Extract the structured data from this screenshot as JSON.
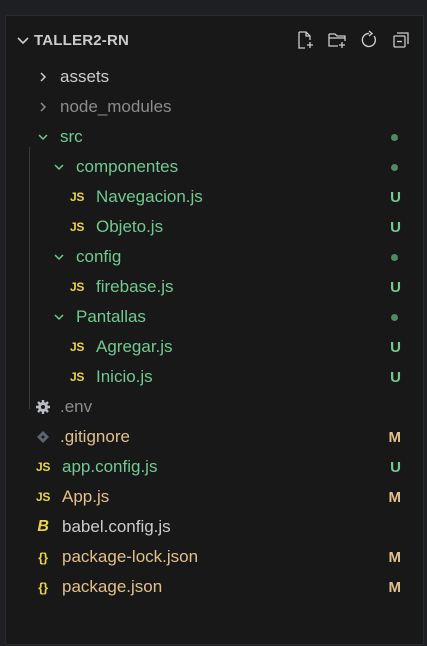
{
  "explorer": {
    "project_title": "TALLER2-RN",
    "actions": [
      {
        "name": "new-file-icon"
      },
      {
        "name": "new-folder-icon"
      },
      {
        "name": "refresh-icon"
      },
      {
        "name": "collapse-all-icon"
      }
    ]
  },
  "tree": {
    "assets": {
      "label": "assets"
    },
    "node_modules": {
      "label": "node_modules"
    },
    "src": {
      "label": "src"
    },
    "componentes": {
      "label": "componentes"
    },
    "navegacion": {
      "label": "Navegacion.js",
      "status": "U"
    },
    "objeto": {
      "label": "Objeto.js",
      "status": "U"
    },
    "config": {
      "label": "config"
    },
    "firebase": {
      "label": "firebase.js",
      "status": "U"
    },
    "pantallas": {
      "label": "Pantallas"
    },
    "agregar": {
      "label": "Agregar.js",
      "status": "U"
    },
    "inicio": {
      "label": "Inicio.js",
      "status": "U"
    },
    "env": {
      "label": ".env"
    },
    "gitignore": {
      "label": ".gitignore",
      "status": "M"
    },
    "app_config": {
      "label": "app.config.js",
      "status": "U"
    },
    "app": {
      "label": "App.js",
      "status": "M"
    },
    "babel": {
      "label": "babel.config.js"
    },
    "package_lock": {
      "label": "package-lock.json",
      "status": "M"
    },
    "package": {
      "label": "package.json",
      "status": "M"
    }
  },
  "icons": {
    "js_badge": "JS",
    "json_badge": "{}",
    "babel_badge": "B"
  },
  "colors": {
    "untracked": "#73c991",
    "modified": "#e2c08d",
    "js_icon": "#e8d44d"
  }
}
